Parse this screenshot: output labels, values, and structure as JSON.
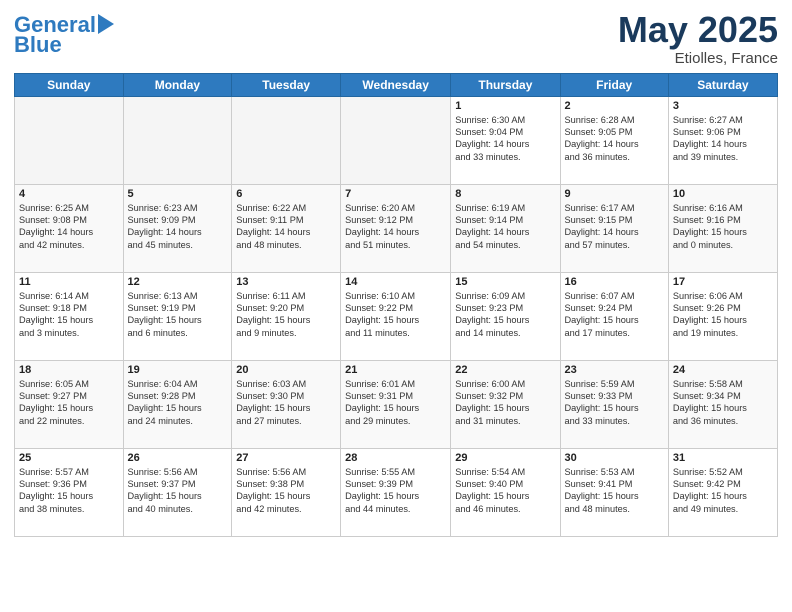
{
  "header": {
    "logo_line1": "General",
    "logo_line2": "Blue",
    "title": "May 2025",
    "subtitle": "Etiolles, France"
  },
  "days_of_week": [
    "Sunday",
    "Monday",
    "Tuesday",
    "Wednesday",
    "Thursday",
    "Friday",
    "Saturday"
  ],
  "weeks": [
    [
      {
        "day": "",
        "info": ""
      },
      {
        "day": "",
        "info": ""
      },
      {
        "day": "",
        "info": ""
      },
      {
        "day": "",
        "info": ""
      },
      {
        "day": "1",
        "info": "Sunrise: 6:30 AM\nSunset: 9:04 PM\nDaylight: 14 hours\nand 33 minutes."
      },
      {
        "day": "2",
        "info": "Sunrise: 6:28 AM\nSunset: 9:05 PM\nDaylight: 14 hours\nand 36 minutes."
      },
      {
        "day": "3",
        "info": "Sunrise: 6:27 AM\nSunset: 9:06 PM\nDaylight: 14 hours\nand 39 minutes."
      }
    ],
    [
      {
        "day": "4",
        "info": "Sunrise: 6:25 AM\nSunset: 9:08 PM\nDaylight: 14 hours\nand 42 minutes."
      },
      {
        "day": "5",
        "info": "Sunrise: 6:23 AM\nSunset: 9:09 PM\nDaylight: 14 hours\nand 45 minutes."
      },
      {
        "day": "6",
        "info": "Sunrise: 6:22 AM\nSunset: 9:11 PM\nDaylight: 14 hours\nand 48 minutes."
      },
      {
        "day": "7",
        "info": "Sunrise: 6:20 AM\nSunset: 9:12 PM\nDaylight: 14 hours\nand 51 minutes."
      },
      {
        "day": "8",
        "info": "Sunrise: 6:19 AM\nSunset: 9:14 PM\nDaylight: 14 hours\nand 54 minutes."
      },
      {
        "day": "9",
        "info": "Sunrise: 6:17 AM\nSunset: 9:15 PM\nDaylight: 14 hours\nand 57 minutes."
      },
      {
        "day": "10",
        "info": "Sunrise: 6:16 AM\nSunset: 9:16 PM\nDaylight: 15 hours\nand 0 minutes."
      }
    ],
    [
      {
        "day": "11",
        "info": "Sunrise: 6:14 AM\nSunset: 9:18 PM\nDaylight: 15 hours\nand 3 minutes."
      },
      {
        "day": "12",
        "info": "Sunrise: 6:13 AM\nSunset: 9:19 PM\nDaylight: 15 hours\nand 6 minutes."
      },
      {
        "day": "13",
        "info": "Sunrise: 6:11 AM\nSunset: 9:20 PM\nDaylight: 15 hours\nand 9 minutes."
      },
      {
        "day": "14",
        "info": "Sunrise: 6:10 AM\nSunset: 9:22 PM\nDaylight: 15 hours\nand 11 minutes."
      },
      {
        "day": "15",
        "info": "Sunrise: 6:09 AM\nSunset: 9:23 PM\nDaylight: 15 hours\nand 14 minutes."
      },
      {
        "day": "16",
        "info": "Sunrise: 6:07 AM\nSunset: 9:24 PM\nDaylight: 15 hours\nand 17 minutes."
      },
      {
        "day": "17",
        "info": "Sunrise: 6:06 AM\nSunset: 9:26 PM\nDaylight: 15 hours\nand 19 minutes."
      }
    ],
    [
      {
        "day": "18",
        "info": "Sunrise: 6:05 AM\nSunset: 9:27 PM\nDaylight: 15 hours\nand 22 minutes."
      },
      {
        "day": "19",
        "info": "Sunrise: 6:04 AM\nSunset: 9:28 PM\nDaylight: 15 hours\nand 24 minutes."
      },
      {
        "day": "20",
        "info": "Sunrise: 6:03 AM\nSunset: 9:30 PM\nDaylight: 15 hours\nand 27 minutes."
      },
      {
        "day": "21",
        "info": "Sunrise: 6:01 AM\nSunset: 9:31 PM\nDaylight: 15 hours\nand 29 minutes."
      },
      {
        "day": "22",
        "info": "Sunrise: 6:00 AM\nSunset: 9:32 PM\nDaylight: 15 hours\nand 31 minutes."
      },
      {
        "day": "23",
        "info": "Sunrise: 5:59 AM\nSunset: 9:33 PM\nDaylight: 15 hours\nand 33 minutes."
      },
      {
        "day": "24",
        "info": "Sunrise: 5:58 AM\nSunset: 9:34 PM\nDaylight: 15 hours\nand 36 minutes."
      }
    ],
    [
      {
        "day": "25",
        "info": "Sunrise: 5:57 AM\nSunset: 9:36 PM\nDaylight: 15 hours\nand 38 minutes."
      },
      {
        "day": "26",
        "info": "Sunrise: 5:56 AM\nSunset: 9:37 PM\nDaylight: 15 hours\nand 40 minutes."
      },
      {
        "day": "27",
        "info": "Sunrise: 5:56 AM\nSunset: 9:38 PM\nDaylight: 15 hours\nand 42 minutes."
      },
      {
        "day": "28",
        "info": "Sunrise: 5:55 AM\nSunset: 9:39 PM\nDaylight: 15 hours\nand 44 minutes."
      },
      {
        "day": "29",
        "info": "Sunrise: 5:54 AM\nSunset: 9:40 PM\nDaylight: 15 hours\nand 46 minutes."
      },
      {
        "day": "30",
        "info": "Sunrise: 5:53 AM\nSunset: 9:41 PM\nDaylight: 15 hours\nand 48 minutes."
      },
      {
        "day": "31",
        "info": "Sunrise: 5:52 AM\nSunset: 9:42 PM\nDaylight: 15 hours\nand 49 minutes."
      }
    ]
  ]
}
